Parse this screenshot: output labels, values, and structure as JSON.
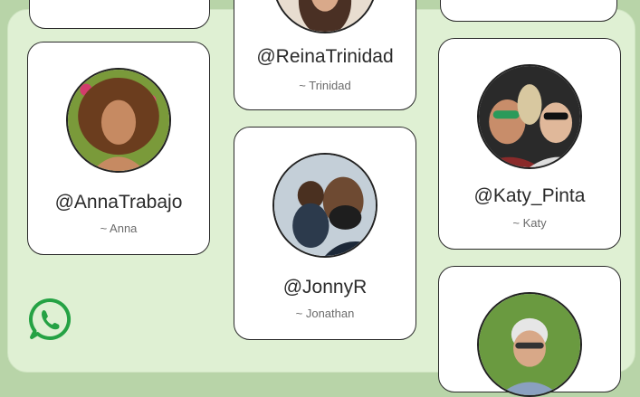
{
  "profiles": [
    {
      "handle": "@ReinaTrinidad",
      "name": "~ Trinidad"
    },
    {
      "handle": "@AnnaTrabajo",
      "name": "~ Anna"
    },
    {
      "handle": "@Katy_Pinta",
      "name": "~ Katy"
    },
    {
      "handle": "@JonnyR",
      "name": "~ Jonathan"
    }
  ],
  "icons": {
    "app_logo": "whatsapp-icon"
  },
  "colors": {
    "background": "#dff0d3",
    "accent": "#25a244",
    "card": "#ffffff"
  }
}
